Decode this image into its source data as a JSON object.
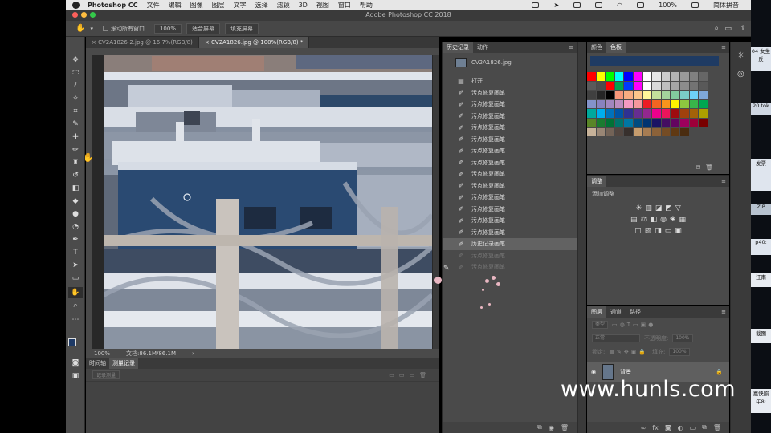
{
  "menubar": {
    "app_name": "Photoshop CC",
    "items": [
      "文件",
      "编辑",
      "图像",
      "图层",
      "文字",
      "选择",
      "滤镜",
      "3D",
      "视图",
      "窗口",
      "帮助"
    ],
    "battery": "100%",
    "input_method": "简体拼音"
  },
  "window": {
    "title": "Adobe Photoshop CC 2018"
  },
  "options_bar": {
    "scroll_all_windows": "滚动所有窗口",
    "zoom": "100%",
    "fit_screen": "适合屏幕",
    "fill_screen": "填充屏幕"
  },
  "doc_tabs": [
    {
      "label": "CV2A1826-2.jpg @ 16.7%(RGB/8)",
      "active": false
    },
    {
      "label": "CV2A1826.jpg @ 100%(RGB/8) *",
      "active": true
    }
  ],
  "status": {
    "zoom": "100%",
    "doc_size": "文档:86.1M/86.1M"
  },
  "bottom_panel": {
    "tabs": [
      "时间轴",
      "测量记录"
    ],
    "record_button": "记录测量"
  },
  "history_panel": {
    "tabs": [
      "历史记录",
      "动作"
    ],
    "snapshot": "CV2A1826.jpg",
    "items": [
      {
        "label": "打开",
        "icon": "document-icon",
        "state": "normal"
      },
      {
        "label": "污点修复画笔",
        "icon": "brush-icon",
        "state": "normal"
      },
      {
        "label": "污点修复画笔",
        "icon": "brush-icon",
        "state": "normal"
      },
      {
        "label": "污点修复画笔",
        "icon": "brush-icon",
        "state": "normal"
      },
      {
        "label": "污点修复画笔",
        "icon": "brush-icon",
        "state": "normal"
      },
      {
        "label": "污点修复画笔",
        "icon": "brush-icon",
        "state": "normal"
      },
      {
        "label": "污点修复画笔",
        "icon": "brush-icon",
        "state": "normal"
      },
      {
        "label": "污点修复画笔",
        "icon": "brush-icon",
        "state": "normal"
      },
      {
        "label": "污点修复画笔",
        "icon": "brush-icon",
        "state": "normal"
      },
      {
        "label": "污点修复画笔",
        "icon": "brush-icon",
        "state": "normal"
      },
      {
        "label": "污点修复画笔",
        "icon": "brush-icon",
        "state": "normal"
      },
      {
        "label": "污点修复画笔",
        "icon": "brush-icon",
        "state": "normal"
      },
      {
        "label": "污点修复画笔",
        "icon": "brush-icon",
        "state": "normal"
      },
      {
        "label": "污点修复画笔",
        "icon": "brush-icon",
        "state": "normal"
      },
      {
        "label": "历史记录画笔",
        "icon": "brush-icon",
        "state": "selected"
      },
      {
        "label": "污点修复画笔",
        "icon": "brush-icon",
        "state": "dim"
      },
      {
        "label": "污点修复画笔",
        "icon": "brush-icon",
        "state": "dim"
      }
    ]
  },
  "swatches_panel": {
    "tabs": [
      "颜色",
      "色板"
    ]
  },
  "adjustments_panel": {
    "title": "调整",
    "subtitle": "添加调整"
  },
  "layers_panel": {
    "tabs": [
      "图层",
      "通道",
      "路径"
    ],
    "kind": "类型",
    "blend_mode": "正常",
    "opacity_label": "不透明度:",
    "opacity": "100%",
    "lock_label": "锁定:",
    "fill_label": "填充:",
    "fill": "100%",
    "layer_name": "背景"
  },
  "right_strip": [
    "04 女生",
    "反",
    "20.tok",
    "发票",
    "ZIP",
    "p40:",
    "江南",
    "截图",
    "嘉快照",
    "午8:"
  ],
  "watermark": "www.hunls.com",
  "colors": {
    "accent": "#1f3b63",
    "selected_row": "#626262"
  }
}
